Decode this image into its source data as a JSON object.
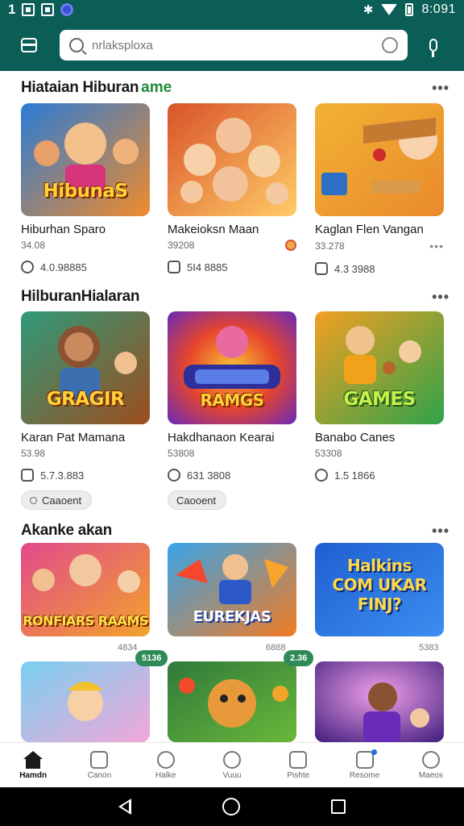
{
  "status_bar": {
    "left_number": "1",
    "time": "8:091"
  },
  "search": {
    "placeholder": "nrlaksploxa"
  },
  "sections": [
    {
      "title": "Hiataian Hiburan",
      "title_accent": "ame",
      "more": "•••",
      "cards": [
        {
          "thumb_text": "HibunaS",
          "title": "Hiburhan Sparo",
          "sub": "34.08",
          "stat": "4.0.98885",
          "colors": [
            "#2a7bd6",
            "#f08b2b"
          ]
        },
        {
          "thumb_text": "",
          "title": "Makeioksn Maan",
          "sub": "39208",
          "stat": "5I4 8885",
          "colors": [
            "#d9532a",
            "#ffcc66"
          ]
        },
        {
          "thumb_text": "",
          "title": "Kaglan Flen Vangan",
          "sub": "33.278",
          "stat": "4.3 3988",
          "colors": [
            "#f2b233",
            "#e98a2c"
          ]
        }
      ]
    },
    {
      "title": "HilburanHialaran",
      "title_accent": "",
      "more": "•••",
      "cards": [
        {
          "thumb_text": "GRAGIR",
          "title": "Karan Pat Mamana",
          "sub": "53.98",
          "stat": "5.7.3.883",
          "colors": [
            "#2f9a7a",
            "#9c4d1e"
          ]
        },
        {
          "thumb_text": "RAMGS",
          "title": "Hakdhanaon Kearai",
          "sub": "53808",
          "stat": "631 3808",
          "colors": [
            "#e8452c",
            "#6a2bb8"
          ]
        },
        {
          "thumb_text": "GAMES",
          "title": "Banabo Canes",
          "sub": "53308",
          "stat": "1.5 1866",
          "colors": [
            "#f2a021",
            "#2fa24a"
          ]
        }
      ],
      "chips": [
        "Caaoent",
        "Caooent"
      ]
    },
    {
      "title": "Akanke akan",
      "title_accent": "",
      "more": "•••",
      "cards": [
        {
          "thumb_text": "RONFIARS RAAMS",
          "meta": "4834",
          "colors": [
            "#e24a8c",
            "#f2a32a"
          ]
        },
        {
          "thumb_text": "EUREKJAS",
          "meta": "6888",
          "colors": [
            "#38a5e8",
            "#f27a22"
          ]
        },
        {
          "thumb_text": "Halkins COM UKAR FINJ?",
          "meta": "5383",
          "colors": [
            "#1f5fd1",
            "#3b8ef0"
          ]
        }
      ]
    }
  ],
  "row4_badges": [
    "5136",
    "2.36"
  ],
  "bottom_nav": [
    {
      "label": "Hamdn",
      "icon": "home-icon"
    },
    {
      "label": "Canon",
      "icon": "game-icon"
    },
    {
      "label": "Halke",
      "icon": "search-icon"
    },
    {
      "label": "Vuuu",
      "icon": "globe-icon"
    },
    {
      "label": "Pishte",
      "icon": "play-icon"
    },
    {
      "label": "Resome",
      "icon": "trophy-icon"
    },
    {
      "label": "Maeos",
      "icon": "more-icon"
    }
  ]
}
